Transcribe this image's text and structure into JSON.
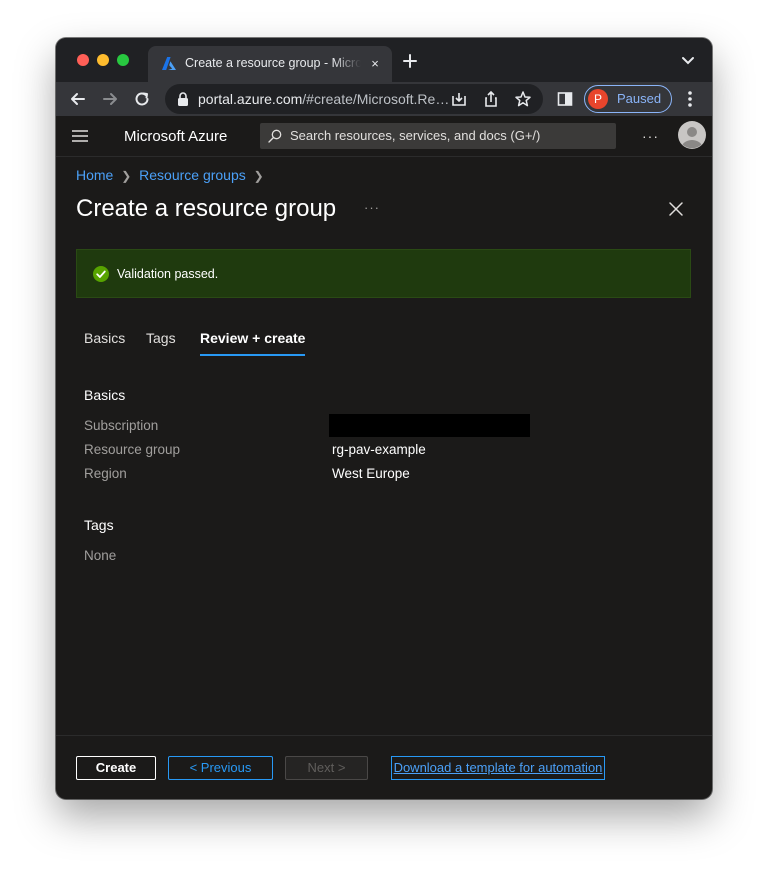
{
  "browser": {
    "tab_title": "Create a resource group - Microsoft Azure",
    "tab_close": "×",
    "url_host": "portal.azure.com",
    "url_path": "/#create/Microsoft.ResourceGroup",
    "profile_initial": "P",
    "profile_status": "Paused"
  },
  "azure_header": {
    "brand": "Microsoft Azure",
    "search_placeholder": "Search resources, services, and docs (G+/)",
    "more": "···"
  },
  "breadcrumb": {
    "items": [
      "Home",
      "Resource groups"
    ]
  },
  "page": {
    "title": "Create a resource group",
    "more": "···"
  },
  "validation": {
    "message": "Validation passed."
  },
  "tabs": [
    "Basics",
    "Tags",
    "Review + create"
  ],
  "review": {
    "basics_heading": "Basics",
    "rows": [
      {
        "label": "Subscription",
        "value": ""
      },
      {
        "label": "Resource group",
        "value": "rg-pav-example"
      },
      {
        "label": "Region",
        "value": "West Europe"
      }
    ],
    "tags_heading": "Tags",
    "tags_value": "None"
  },
  "footer": {
    "create": "Create",
    "previous": "< Previous",
    "next": "Next >",
    "download_link": "Download a template for automation"
  },
  "colors": {
    "accent": "#2899f5",
    "success_banner": "#1f3a0e",
    "success_icon": "#57a300"
  }
}
